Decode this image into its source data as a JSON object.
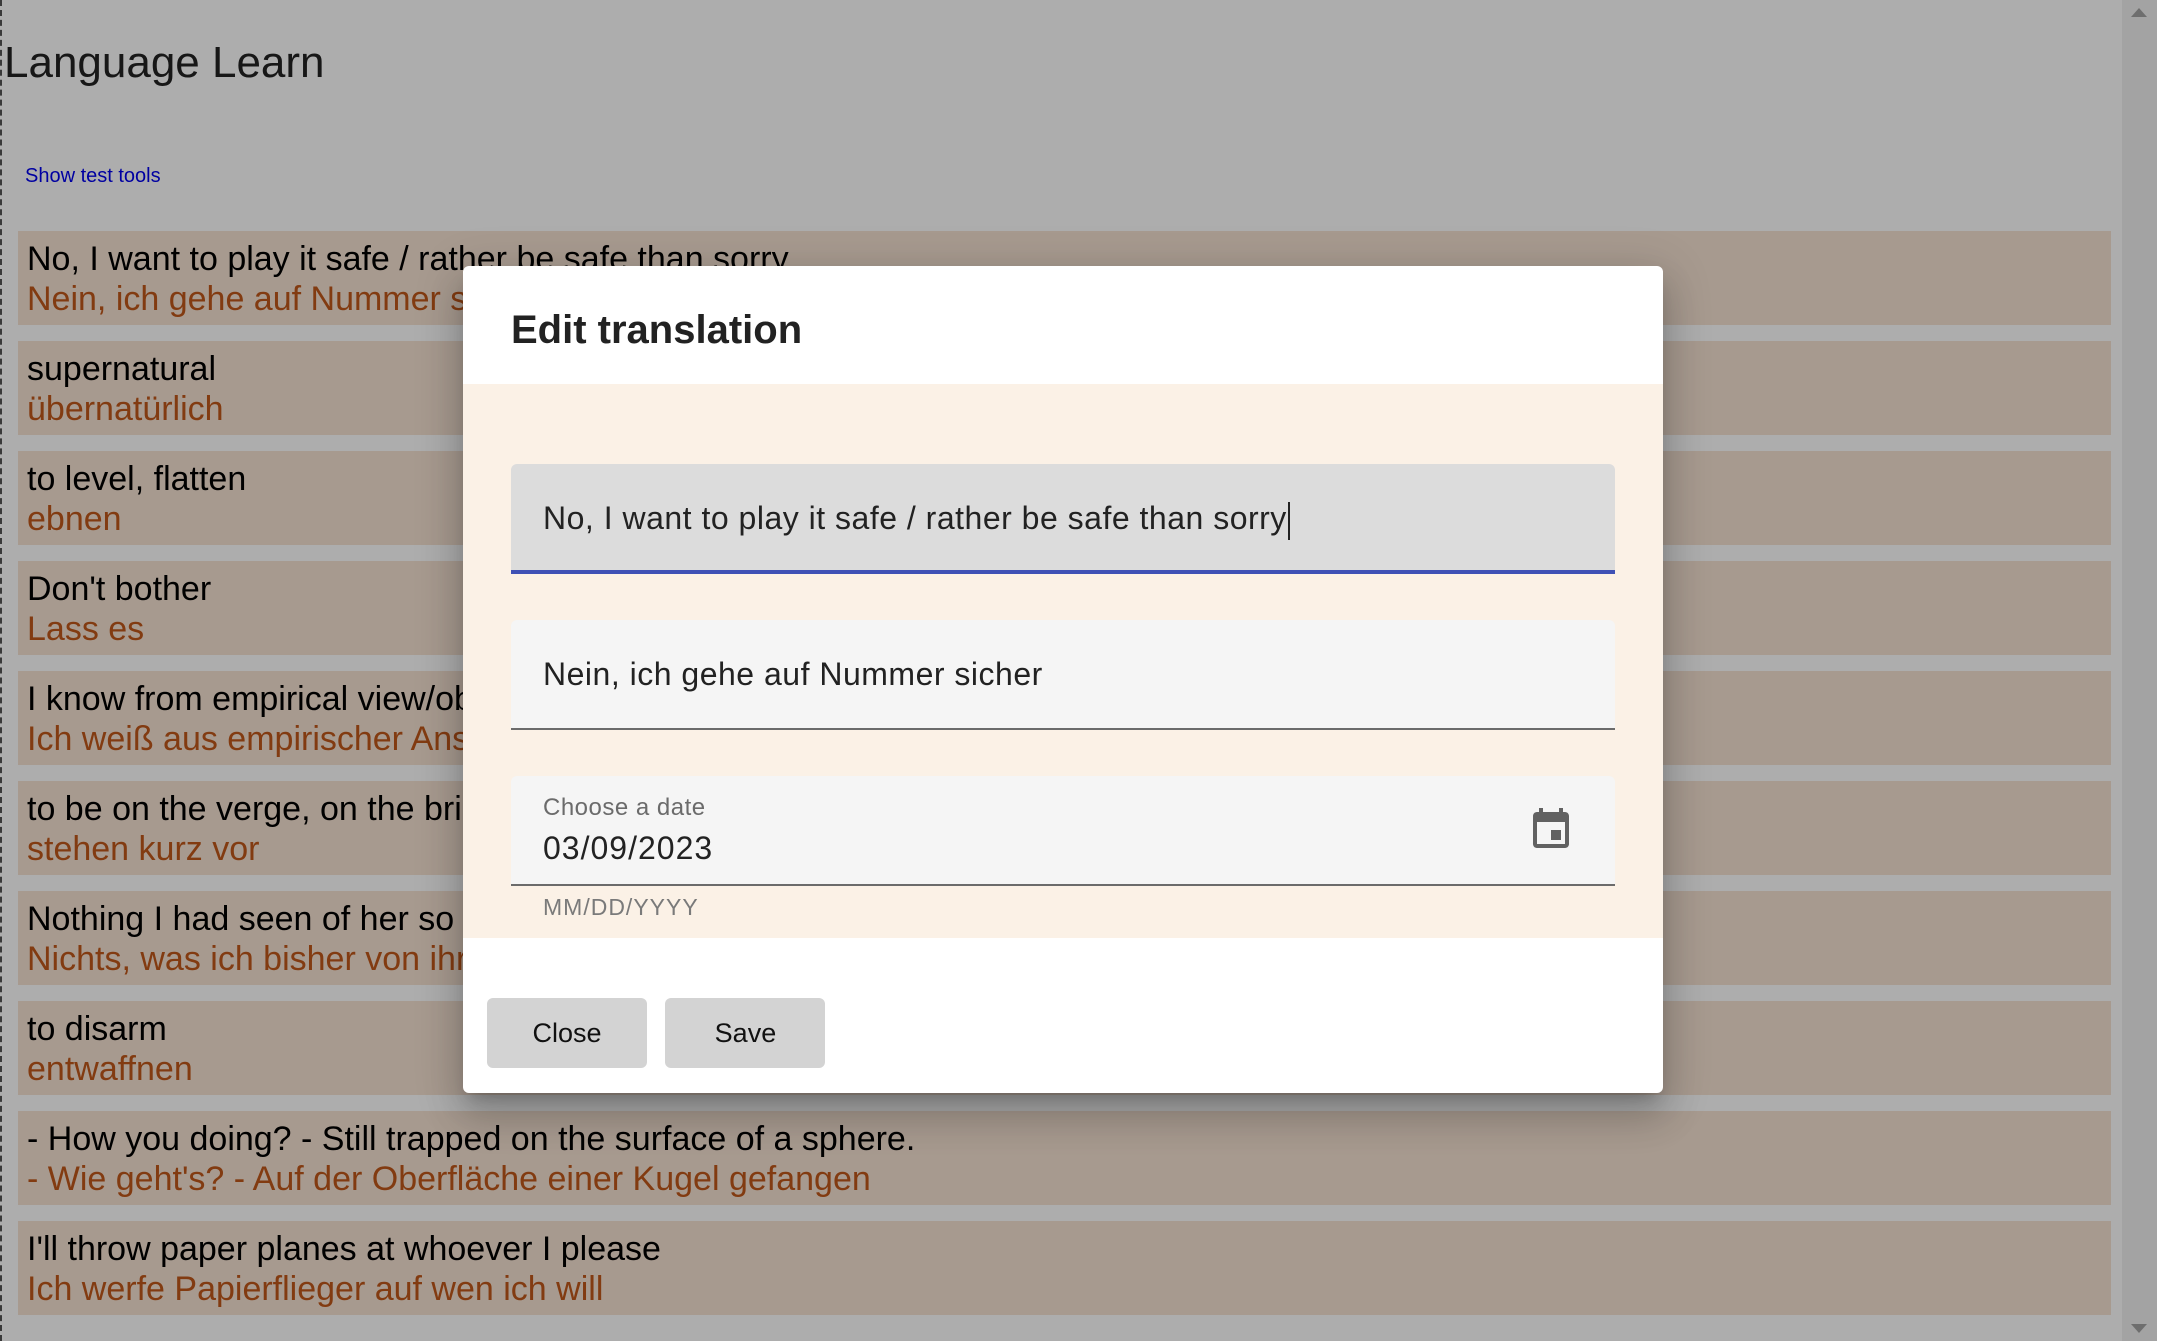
{
  "app": {
    "title": "Language Learn",
    "test_tools_link": "Show test tools"
  },
  "translations": [
    {
      "en": "No, I want to play it safe / rather be safe than sorry",
      "de": "Nein, ich gehe auf Nummer sicher"
    },
    {
      "en": "supernatural",
      "de": "übernatürlich"
    },
    {
      "en": "to level, flatten",
      "de": "ebnen"
    },
    {
      "en": "Don't bother",
      "de": "Lass es"
    },
    {
      "en": "I know from empirical view/observation",
      "de": "Ich weiß aus empirischer Anschauung"
    },
    {
      "en": "to be on the verge, on the brink",
      "de": "stehen kurz vor"
    },
    {
      "en": "Nothing I had seen of her so far suggested she had the fire of poetry in her",
      "de": "Nichts, was ich bisher von ihr gesehen hatte, deutete darauf hin, dass sie das Feuer der Dichtkunst"
    },
    {
      "en": "to disarm",
      "de": "entwaffnen"
    },
    {
      "en": "- How you doing? - Still trapped on the surface of a sphere.",
      "de": "- Wie geht's? - Auf der Oberfläche einer Kugel gefangen"
    },
    {
      "en": "I'll throw paper planes at whoever I please",
      "de": "Ich werfe Papierflieger auf wen ich will"
    }
  ],
  "dialog": {
    "title": "Edit translation",
    "source_value": "No, I want to play it safe / rather be safe than sorry",
    "target_value": "Nein, ich gehe auf Nummer sicher",
    "date_label": "Choose a date",
    "date_value": "03/09/2023",
    "date_hint": "MM/DD/YYYY",
    "calendar_icon": "calendar-icon",
    "close_label": "Close",
    "save_label": "Save"
  },
  "colors": {
    "card_background": "#f7e3d3",
    "translation_text": "#c0581a",
    "focus_underline": "#3f51b5",
    "dialog_body": "#fbf1e6"
  }
}
